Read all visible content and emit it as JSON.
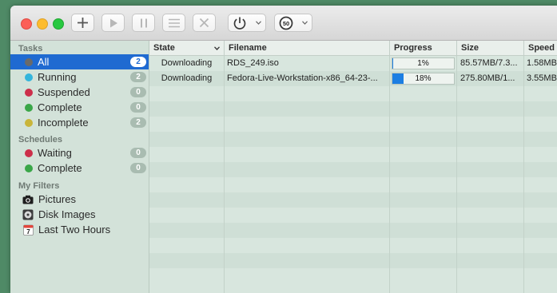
{
  "toolbar": {
    "add_icon": "plus-icon",
    "start_icon": "play-icon",
    "pause_icon": "pause-icon",
    "list_icon": "list-icon",
    "remove_icon": "x-icon",
    "power_icon": "power-icon",
    "speed_limit_label": "50"
  },
  "sidebar": {
    "tasks_header": "Tasks",
    "schedules_header": "Schedules",
    "filters_header": "My Filters",
    "tasks": [
      {
        "label": "All",
        "count": "2",
        "color": "#6a6a6a"
      },
      {
        "label": "Running",
        "count": "2",
        "color": "#34b5dc"
      },
      {
        "label": "Suspended",
        "count": "0",
        "color": "#cc2f4a"
      },
      {
        "label": "Complete",
        "count": "0",
        "color": "#3aa648"
      },
      {
        "label": "Incomplete",
        "count": "2",
        "color": "#c9b53a"
      }
    ],
    "schedules": [
      {
        "label": "Waiting",
        "count": "0",
        "color": "#cc2f4a"
      },
      {
        "label": "Complete",
        "count": "0",
        "color": "#3aa648"
      }
    ],
    "filters": [
      {
        "label": "Pictures",
        "icon": "camera-icon"
      },
      {
        "label": "Disk Images",
        "icon": "disk-icon"
      },
      {
        "label": "Last Two Hours",
        "icon": "calendar-icon"
      }
    ],
    "calendar_day": "7"
  },
  "table": {
    "columns": {
      "state": "State",
      "filename": "Filename",
      "progress": "Progress",
      "size": "Size",
      "speed": "Speed"
    },
    "rows": [
      {
        "state": "Downloading",
        "filename": "RDS_249.iso",
        "progress": 1,
        "progress_label": "1%",
        "size": "85.57MB/7.3...",
        "speed": "1.58MB"
      },
      {
        "state": "Downloading",
        "filename": "Fedora-Live-Workstation-x86_64-23-...",
        "progress": 18,
        "progress_label": "18%",
        "size": "275.80MB/1...",
        "speed": "3.55MB"
      }
    ]
  }
}
